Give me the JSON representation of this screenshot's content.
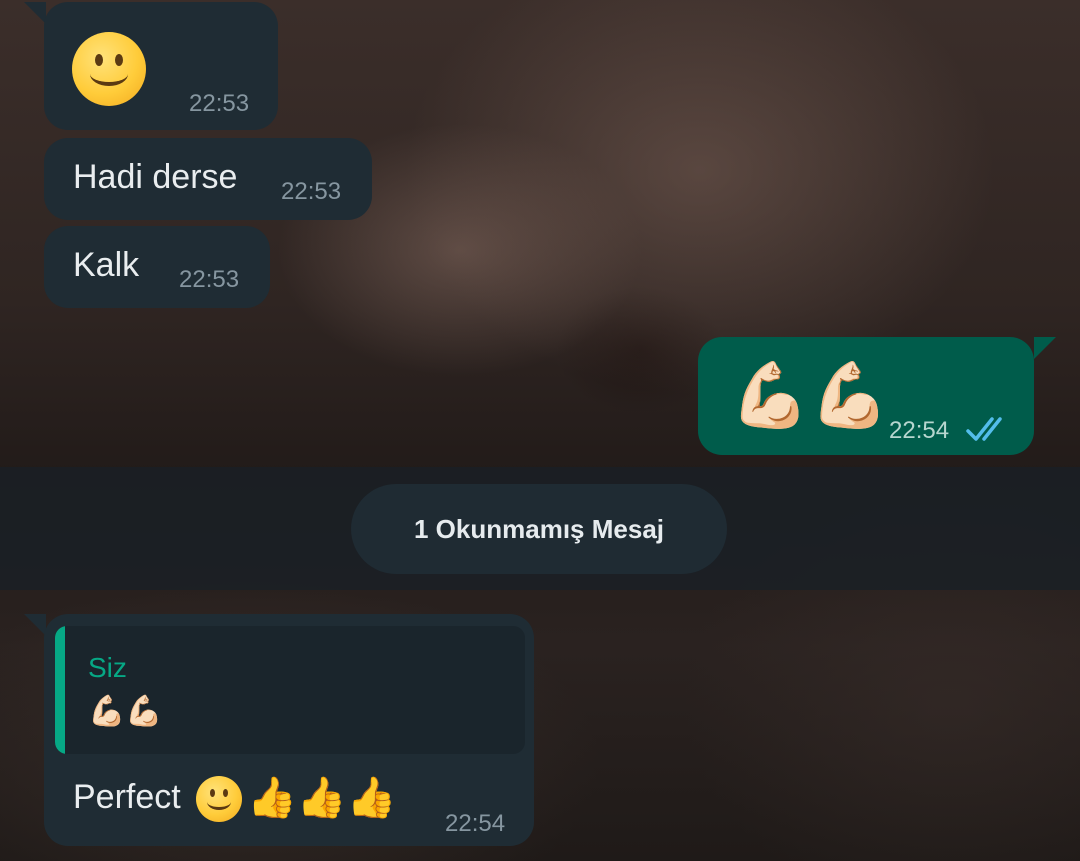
{
  "colors": {
    "incoming_bubble": "#1f2c34",
    "outgoing_bubble": "#005c4b",
    "timestamp": "#8696a0",
    "read_ticks": "#53bdeb",
    "quote_accent": "#06a885",
    "unread_pill": "#1f2b33"
  },
  "messages": [
    {
      "direction": "incoming",
      "content_icon": "slightly-smiling-face-emoji",
      "time": "22:53"
    },
    {
      "direction": "incoming",
      "text": "Hadi derse",
      "time": "22:53"
    },
    {
      "direction": "incoming",
      "text": "Kalk",
      "time": "22:53"
    },
    {
      "direction": "outgoing",
      "content": "💪🏻💪🏻",
      "time": "22:54",
      "status_icon": "double-check-read-icon"
    }
  ],
  "unread_divider": {
    "label": "1 Okunmamış Mesaj"
  },
  "reply_message": {
    "direction": "incoming",
    "quote": {
      "author": "Siz",
      "text": "💪🏻💪🏻"
    },
    "text": "Perfect",
    "emoji_suffix": "👍👍👍",
    "time": "22:54"
  }
}
